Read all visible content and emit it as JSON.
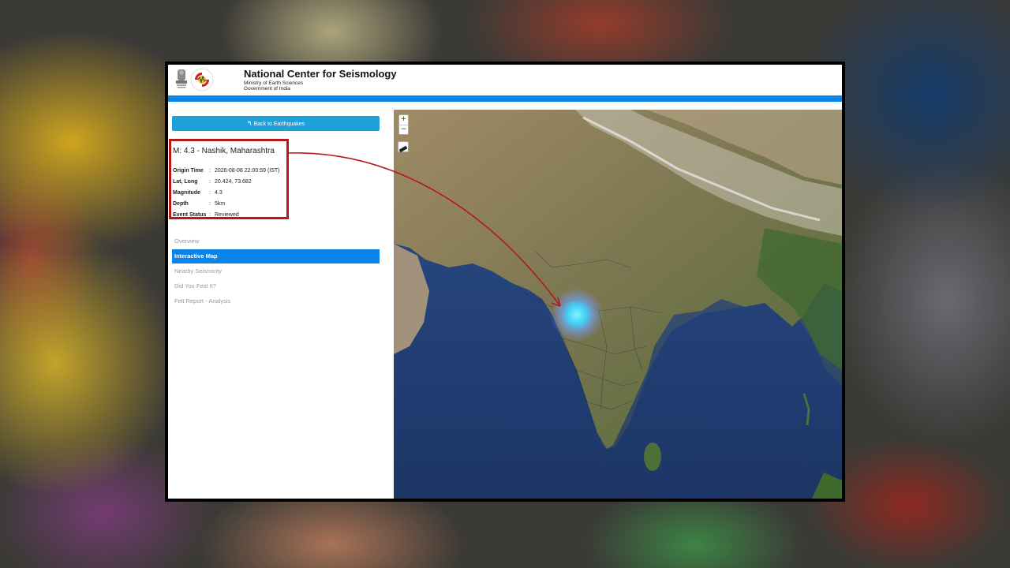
{
  "header": {
    "title": "National Center for Seismology",
    "subtitle1": "Ministry of Earth Sciences",
    "subtitle2": "Government of India"
  },
  "back_button": {
    "label": "Back to Earthquakes"
  },
  "event": {
    "title": "M: 4.3 - Nashik, Maharashtra",
    "details": [
      {
        "label": "Origin Time",
        "value": "2026-08-08 22:00:59 (IST)"
      },
      {
        "label": "Lat, Long",
        "value": "20.424, 73.682"
      },
      {
        "label": "Magnitude",
        "value": "4.3"
      },
      {
        "label": "Depth",
        "value": "5km"
      },
      {
        "label": "Event Status",
        "value": "Reviewed"
      }
    ]
  },
  "menu": {
    "items": [
      {
        "label": "Overview",
        "active": false
      },
      {
        "label": "Interactive Map",
        "active": true
      },
      {
        "label": "Nearby Seismicity",
        "active": false
      },
      {
        "label": "Did You Feel It?",
        "active": false
      },
      {
        "label": "Felt Report - Analysis",
        "active": false
      }
    ]
  },
  "map": {
    "zoom_in": "+",
    "zoom_out": "−"
  },
  "colors": {
    "accent_blue": "#0a84e8",
    "button_blue": "#1ea1d8",
    "highlight_red": "#b51818",
    "epicenter": "#3fd4ff"
  }
}
